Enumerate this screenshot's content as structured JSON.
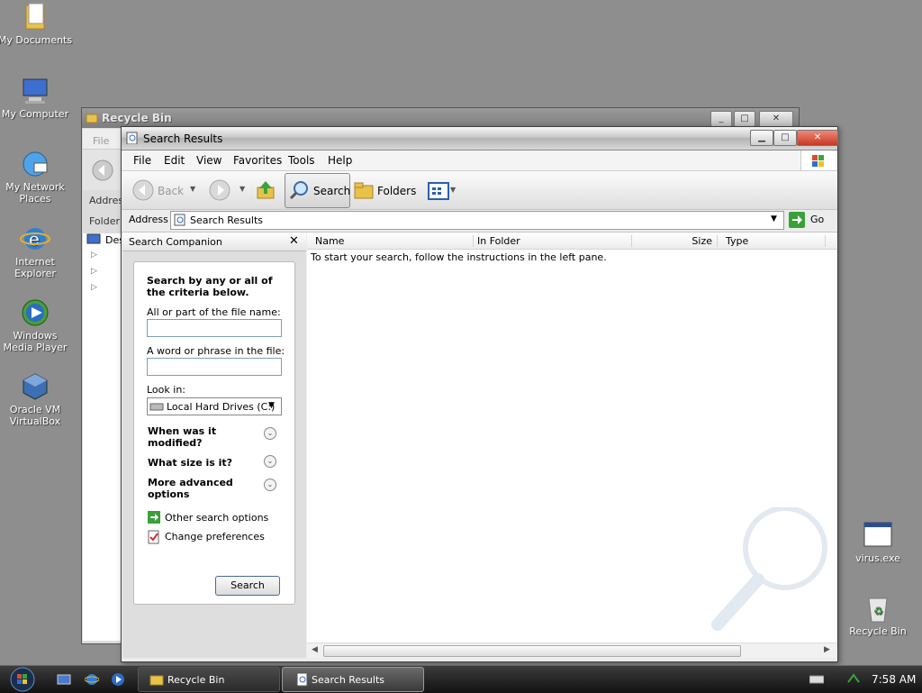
{
  "desktop": {
    "icons": [
      {
        "label": "My Documents",
        "icon": "folder-icon"
      },
      {
        "label": "My Computer",
        "icon": "computer-icon"
      },
      {
        "label": "My Network Places",
        "icon": "network-icon"
      },
      {
        "label": "Internet Explorer",
        "icon": "internet-explorer-icon"
      },
      {
        "label": "Windows Media Player",
        "icon": "media-player-icon"
      },
      {
        "label": "Oracle VM VirtualBox",
        "icon": "virtualbox-icon"
      },
      {
        "label": "virus.exe",
        "icon": "exe-file-icon"
      },
      {
        "label": "Recycle Bin",
        "icon": "recycle-bin-icon"
      }
    ]
  },
  "bg_window": {
    "title": "Recycle Bin",
    "menu_file": "File",
    "address": "Addres",
    "folders": "Folder",
    "tree_item": "Des"
  },
  "window": {
    "title": "Search Results",
    "menu": [
      "File",
      "Edit",
      "View",
      "Favorites",
      "Tools",
      "Help"
    ],
    "toolbar": {
      "back": "Back",
      "search": "Search",
      "folders": "Folders"
    },
    "address": {
      "label": "Address",
      "value": "Search Results",
      "go": "Go"
    }
  },
  "companion": {
    "header": "Search Companion",
    "intro": "Search by any or all of the criteria below.",
    "file_name_label": "All or part of the file name:",
    "file_name_value": "",
    "phrase_label": "A word or phrase in the file:",
    "phrase_value": "",
    "look_in_label": "Look in:",
    "look_in_value": "Local Hard Drives (C:)",
    "when_modified": "When was it modified?",
    "what_size": "What size is it?",
    "advanced": "More advanced options",
    "other_options": "Other search options",
    "change_prefs": "Change preferences",
    "search_button": "Search"
  },
  "results": {
    "columns": [
      "Name",
      "In Folder",
      "Size",
      "Type"
    ],
    "message": "To start your search, follow the instructions in the left pane."
  },
  "taskbar": {
    "tasks": [
      "Recycle Bin",
      "Search Results"
    ],
    "time": "7:58 AM"
  }
}
